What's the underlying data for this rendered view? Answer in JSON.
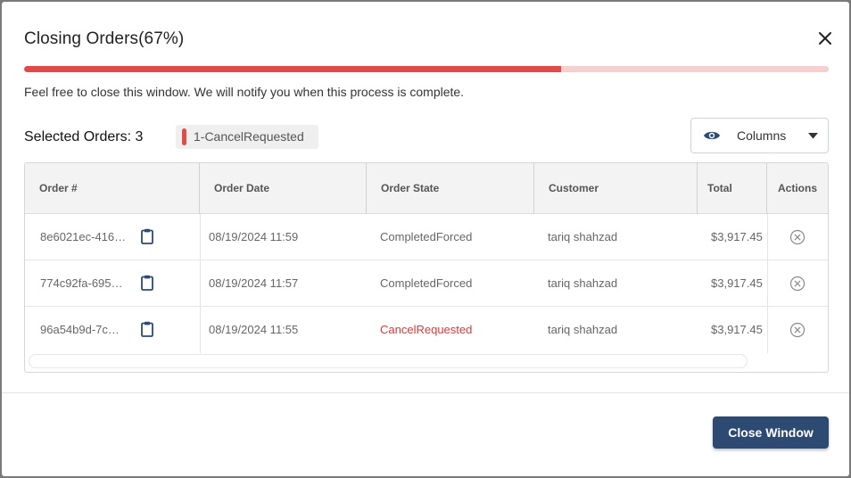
{
  "modal": {
    "title": "Closing Orders(67%)",
    "progress_fraction": 0.667,
    "notice": "Feel free to close this window. We will notify you when this process is complete.",
    "selected_label": "Selected Orders: 3",
    "chip_label": "1-CancelRequested",
    "columns_label": "Columns",
    "close_window_label": "Close Window"
  },
  "colors": {
    "accent_red": "#e24a4a",
    "primary_button": "#2d4a72"
  },
  "table": {
    "columns": [
      "Order #",
      "Order Date",
      "Order State",
      "Customer",
      "Total",
      "Actions"
    ],
    "rows": [
      {
        "order": "8e6021ec-416…",
        "date": "08/19/2024 11:59",
        "state": "CompletedForced",
        "customer": "tariq shahzad",
        "total": "$3,917.45"
      },
      {
        "order": "774c92fa-695…",
        "date": "08/19/2024 11:57",
        "state": "CompletedForced",
        "customer": "tariq shahzad",
        "total": "$3,917.45"
      },
      {
        "order": "96a54b9d-7c…",
        "date": "08/19/2024 11:55",
        "state": "CancelRequested",
        "customer": "tariq shahzad",
        "total": "$3,917.45"
      }
    ]
  },
  "icons": {
    "close": "close-icon",
    "eye": "eye-icon",
    "caret": "caret-down-icon",
    "clipboard": "clipboard-icon",
    "cancel": "cancel-circle-icon"
  }
}
